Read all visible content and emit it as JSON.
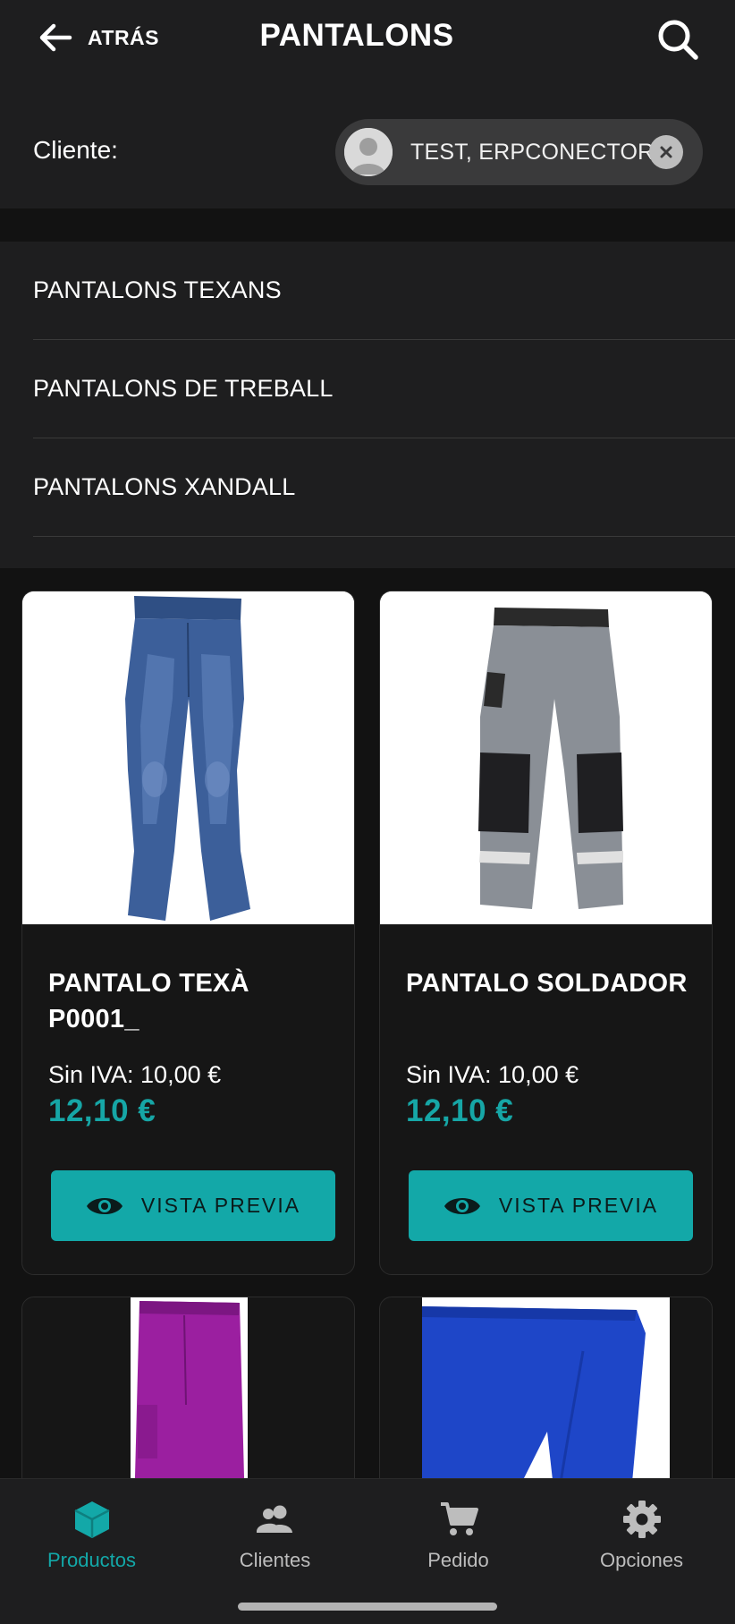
{
  "header": {
    "back_label": "ATRÁS",
    "title": "PANTALONS",
    "client_label": "Cliente:",
    "client_name": "TEST, ERPCONECTOR"
  },
  "subcategories": [
    {
      "label": "PANTALONS TEXANS"
    },
    {
      "label": "PANTALONS DE TREBALL"
    },
    {
      "label": "PANTALONS XANDALL"
    }
  ],
  "products": [
    {
      "name": "PANTALO TEXÀ P0001_",
      "price_net": "Sin IVA: 10,00 €",
      "price": "12,10 €",
      "button_label": "VISTA PREVIA"
    },
    {
      "name": "PANTALO SOLDADOR",
      "price_net": "Sin IVA: 10,00 €",
      "price": "12,10 €",
      "button_label": "VISTA PREVIA"
    },
    {
      "name": "",
      "image": "purple-trousers"
    },
    {
      "name": "",
      "image": "blue-trousers"
    }
  ],
  "bottom_nav": [
    {
      "label": "Productos",
      "icon": "cube-icon",
      "active": true
    },
    {
      "label": "Clientes",
      "icon": "users-icon",
      "active": false
    },
    {
      "label": "Pedido",
      "icon": "cart-icon",
      "active": false
    },
    {
      "label": "Opciones",
      "icon": "gear-icon",
      "active": false
    }
  ],
  "colors": {
    "accent": "#13a8a8",
    "background": "#121212",
    "surface": "#1e1e1f"
  }
}
